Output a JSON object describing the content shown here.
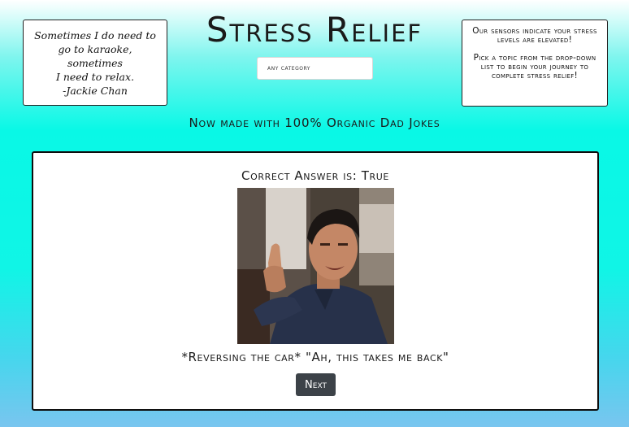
{
  "quote": {
    "lines": [
      "Sometimes I do need to",
      "go to karaoke, sometimes",
      "I need to relax.",
      "-Jackie Chan"
    ]
  },
  "header": {
    "title": "Stress Relief",
    "subtitle": "Now made with 100% Organic Dad Jokes"
  },
  "category_select": {
    "selected": "any category"
  },
  "info": {
    "paragraph1": "Our sensors indicate your stress levels are elevated!",
    "paragraph2": "Pick a topic from the drop-down list to begin your journey to complete stress relief!"
  },
  "card": {
    "answer": "Correct Answer is: True",
    "caption": "*Reversing the car* \"Ah, this takes me back\"",
    "next_label": "Next"
  }
}
